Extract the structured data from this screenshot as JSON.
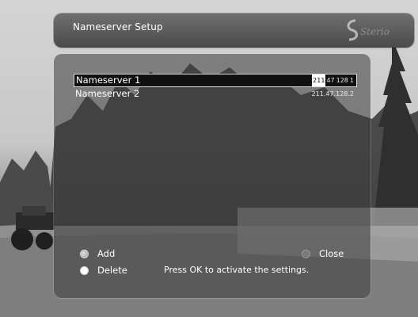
{
  "header": {
    "title": "Nameserver Setup"
  },
  "nameservers": [
    {
      "label": "Nameserver 1",
      "value_parts": [
        "211",
        "47",
        "128",
        "1"
      ],
      "cursor_index": 0,
      "selected": true
    },
    {
      "label": "Nameserver 2",
      "value": "211.47.128.2",
      "selected": false
    }
  ],
  "buttons": {
    "add": "Add",
    "delete": "Delete",
    "close": "Close"
  },
  "hint": "Press OK to activate the settings."
}
